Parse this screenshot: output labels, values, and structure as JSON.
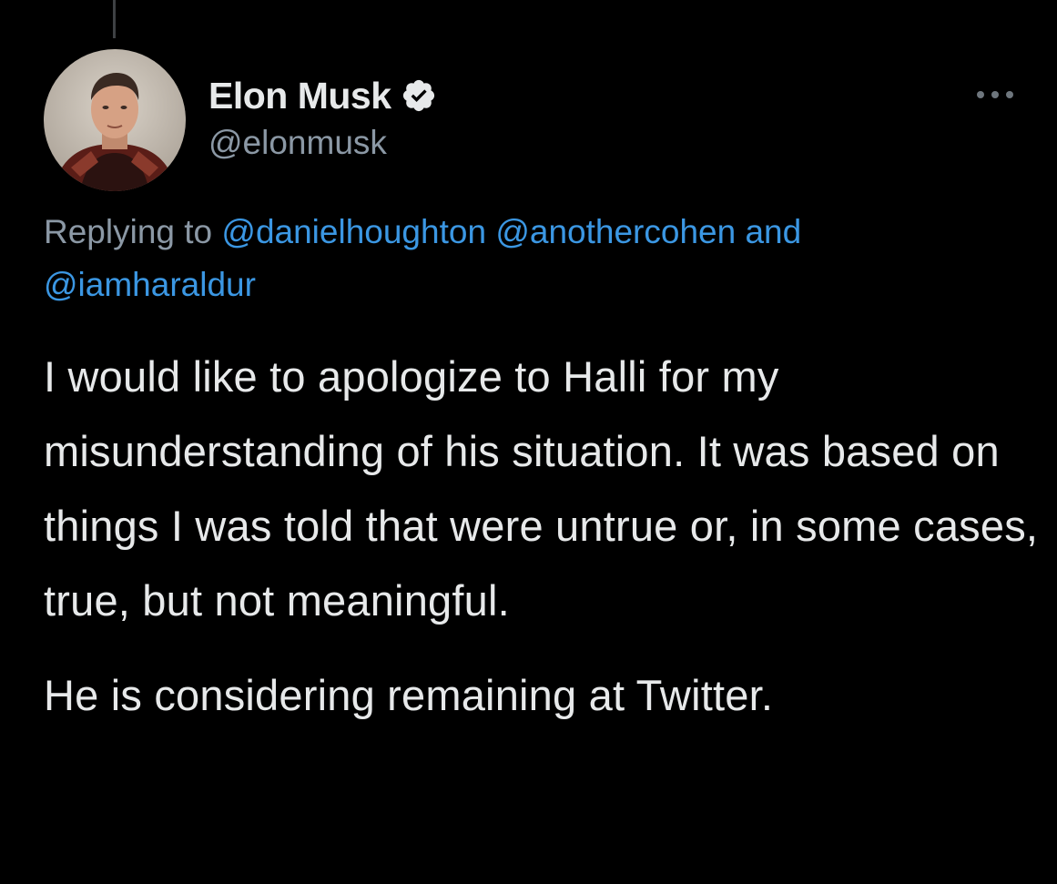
{
  "author": {
    "display_name": "Elon Musk",
    "handle": "@elonmusk",
    "verified": true,
    "avatar_icon": "profile-photo"
  },
  "menu": {
    "icon": "more-horizontal-icon"
  },
  "reply_context": {
    "prefix": "Replying to",
    "mentions": [
      "@danielhoughton",
      "@anothercohen"
    ],
    "conjunction": "and",
    "last_mention": "@iamharaldur"
  },
  "tweet": {
    "paragraphs": [
      "I would like to apologize to Halli for my misunderstanding of his situation. It was based on things I was told that were untrue or, in some cases, true, but not meaningful.",
      "He is considering remaining at Twitter."
    ]
  },
  "colors": {
    "background": "#000000",
    "text_primary": "#e7e9ea",
    "text_secondary": "#8b98a5",
    "link": "#3b97e3"
  }
}
